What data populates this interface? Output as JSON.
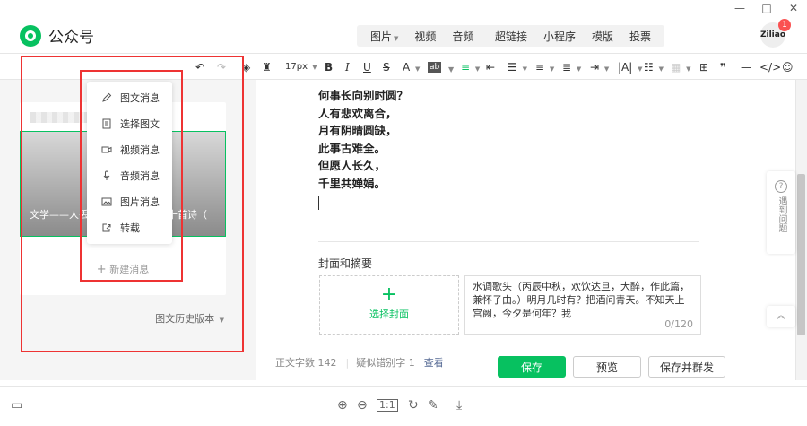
{
  "window": {
    "minimize": "—",
    "maximize": "□",
    "close": "✕"
  },
  "app": {
    "name": "公众号"
  },
  "insert_media": [
    {
      "label": "图片",
      "dropdown": true
    },
    {
      "label": "视频"
    },
    {
      "label": "音频"
    }
  ],
  "insert_other": [
    {
      "label": "超链接"
    },
    {
      "label": "小程序"
    },
    {
      "label": "模版"
    },
    {
      "label": "投票"
    }
  ],
  "user": {
    "avatar_text": "Ziliao",
    "badge_count": "1"
  },
  "toolbar": {
    "font_size": "17px"
  },
  "left": {
    "article_title": "文学——人丢……上高水平的四十首诗（",
    "new_message": "新建消息",
    "history": "图文历史版本"
  },
  "menu": [
    {
      "label": "图文消息",
      "icon": "pencil-icon"
    },
    {
      "label": "选择图文",
      "icon": "document-icon"
    },
    {
      "label": "视频消息",
      "icon": "video-icon"
    },
    {
      "label": "音频消息",
      "icon": "microphone-icon"
    },
    {
      "label": "图片消息",
      "icon": "image-icon"
    },
    {
      "label": "转载",
      "icon": "share-icon"
    }
  ],
  "editor": {
    "poem": [
      "何事长向别时圆？",
      "人有悲欢离合，",
      "月有阴晴圆缺，",
      "此事古难全。",
      "但愿人长久，",
      "千里共婵娟。"
    ],
    "cover_label": "封面和摘要",
    "cover_button": "选择封面",
    "summary": "水调歌头（丙辰中秋，欢饮达旦，大醉，作此篇，兼怀子由。）明月几时有？把酒问青天。不知天上宫阙，今夕是何年？我",
    "summary_count": "0/120"
  },
  "status": {
    "word_label": "正文字数",
    "word_count": "142",
    "typo_label": "疑似错别字",
    "typo_count": "1",
    "check_link": "查看"
  },
  "buttons": {
    "save": "保存",
    "preview": "预览",
    "save_publish": "保存并群发"
  },
  "helper": {
    "text": "遇到问题"
  },
  "colors": {
    "accent": "#07c160",
    "highlight_box": "#e33333",
    "link": "#576b95"
  }
}
